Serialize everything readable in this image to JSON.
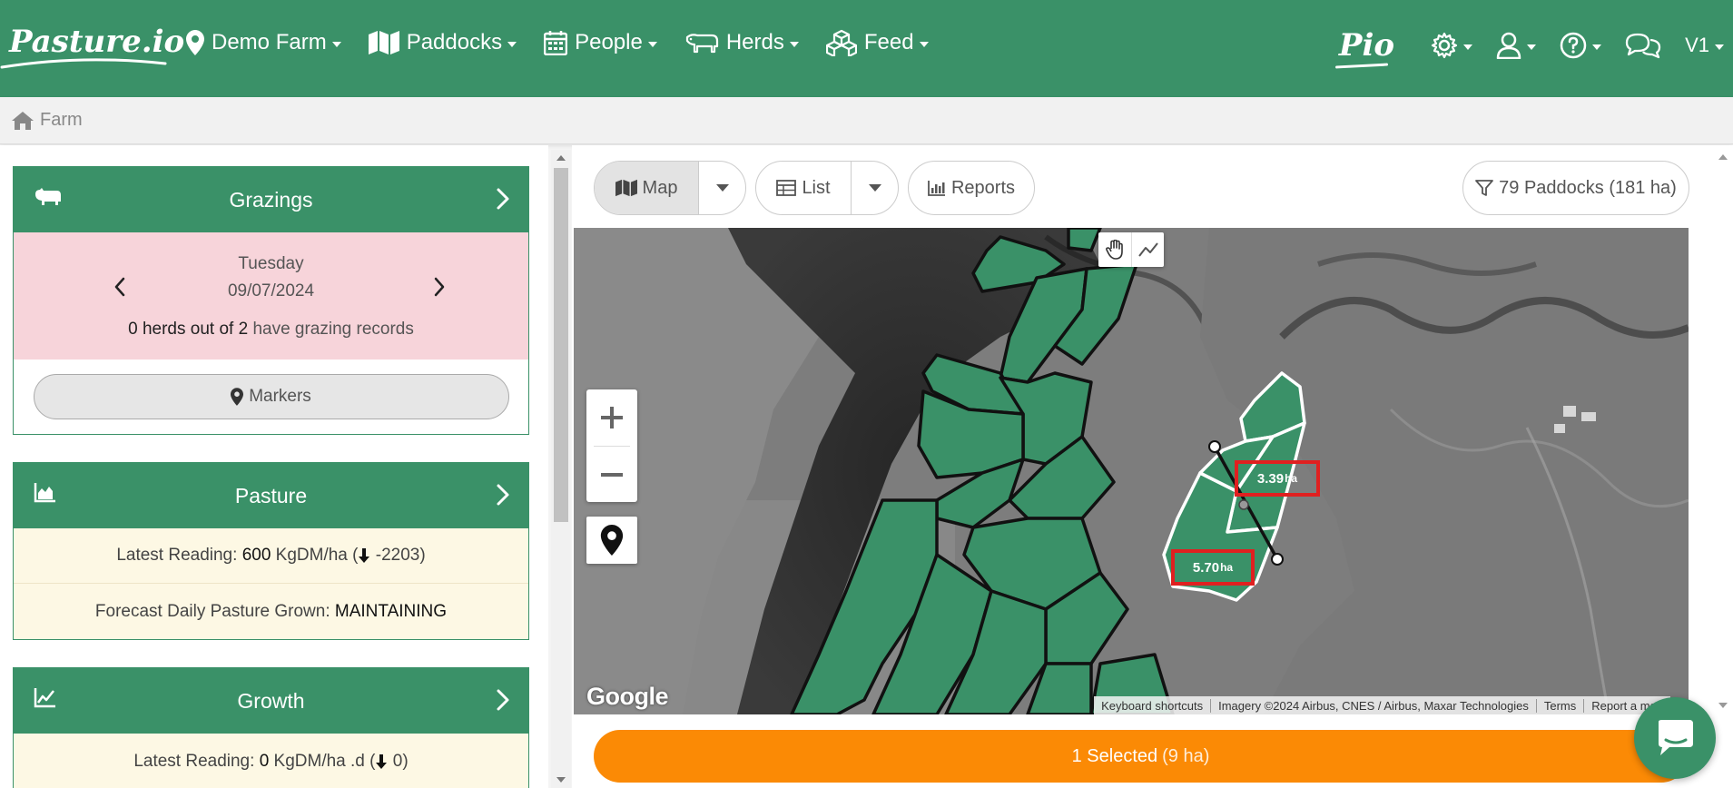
{
  "navbar": {
    "brand": "Pasture.io",
    "items": [
      {
        "label": "Demo Farm",
        "icon": "map-marker-icon"
      },
      {
        "label": "Paddocks",
        "icon": "map-icon"
      },
      {
        "label": "People",
        "icon": "calendar-icon"
      },
      {
        "label": "Herds",
        "icon": "cow-icon"
      },
      {
        "label": "Feed",
        "icon": "cubes-icon"
      }
    ],
    "pio": "Pio",
    "version": "V1"
  },
  "breadcrumb": {
    "label": "Farm"
  },
  "grazings": {
    "title": "Grazings",
    "day": "Tuesday",
    "date": "09/07/2024",
    "herds_count": "0 herds out of 2",
    "herds_suffix": "have grazing records",
    "markers_label": "Markers"
  },
  "pasture": {
    "title": "Pasture",
    "latest_prefix": "Latest Reading:",
    "latest_value": "600",
    "latest_unit": "KgDM/ha (",
    "latest_change": "-2203)",
    "forecast_prefix": "Forecast Daily Pasture Grown:",
    "forecast_value": "MAINTAINING"
  },
  "growth": {
    "title": "Growth",
    "latest_prefix": "Latest Reading:",
    "latest_value": "0",
    "latest_unit": "KgDM/ha .d (",
    "latest_change": "0)"
  },
  "toolbar": {
    "map_label": "Map",
    "list_label": "List",
    "reports_label": "Reports",
    "filter_label": "79 Paddocks (181 ha)"
  },
  "map": {
    "area_labels": [
      {
        "value": "3.39",
        "unit": "ha"
      },
      {
        "value": "5.70",
        "unit": "ha"
      }
    ],
    "google_logo": "Google",
    "attribution": [
      "Keyboard shortcuts",
      "Imagery ©2024 Airbus, CNES / Airbus, Maxar Technologies",
      "Terms",
      "Report a map"
    ]
  },
  "selection": {
    "label": "1 Selected",
    "area": "(9 ha)"
  },
  "colors": {
    "brand_green": "#3a9168",
    "accent_orange": "#fb8a05",
    "highlight_red": "#e02020",
    "grazing_pink": "#f7d4da",
    "pasture_cream": "#fdf8e4"
  }
}
